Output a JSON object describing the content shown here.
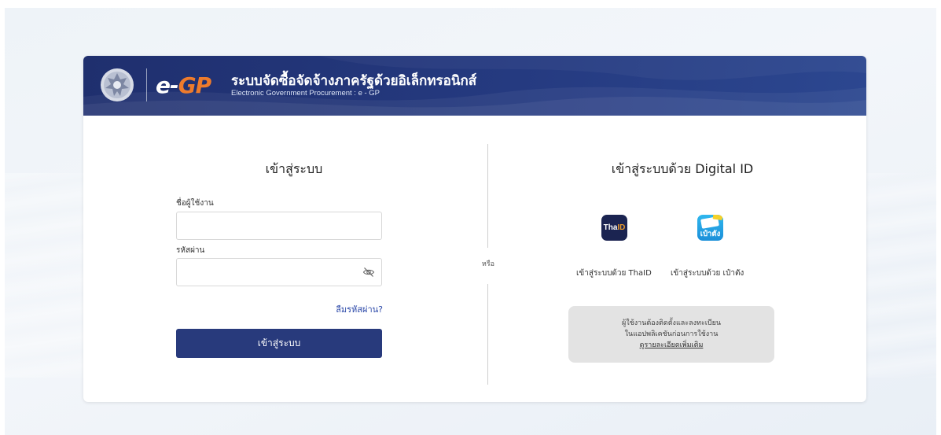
{
  "header": {
    "logo_e": "e-",
    "logo_gp": "GP",
    "title": "ระบบจัดซื้อจัดจ้างภาครัฐด้วยอิเล็กทรอนิกส์",
    "subtitle": "Electronic Government Procurement : e - GP"
  },
  "login": {
    "title": "เข้าสู่ระบบ",
    "username_label": "ชื่อผู้ใช้งาน",
    "username_value": "",
    "password_label": "รหัสผ่าน",
    "password_value": "",
    "forgot_label": "ลืมรหัสผ่าน?",
    "submit_label": "เข้าสู่ระบบ"
  },
  "or_label": "หรือ",
  "digital": {
    "title": "เข้าสู่ระบบด้วย Digital ID",
    "thaid": {
      "icon_text_a": "Tha",
      "icon_text_b": "ID",
      "label": "เข้าสู่ระบบด้วย ThaID"
    },
    "paotang": {
      "icon_text": "เป๋าตัง",
      "label": "เข้าสู่ระบบด้วย เป๋าตัง"
    },
    "info_line1": "ผู้ใช้งานต้องติดตั้งและลงทะเบียน",
    "info_line2": "ในแอปพลิเคชันก่อนการใช้งาน",
    "info_link": "ดูรายละเอียดเพิ่มเติม"
  },
  "colors": {
    "header_navy": "#253a80",
    "button_navy": "#283a7c",
    "brand_orange": "#ee7b2c",
    "link_blue": "#2a47a8"
  }
}
